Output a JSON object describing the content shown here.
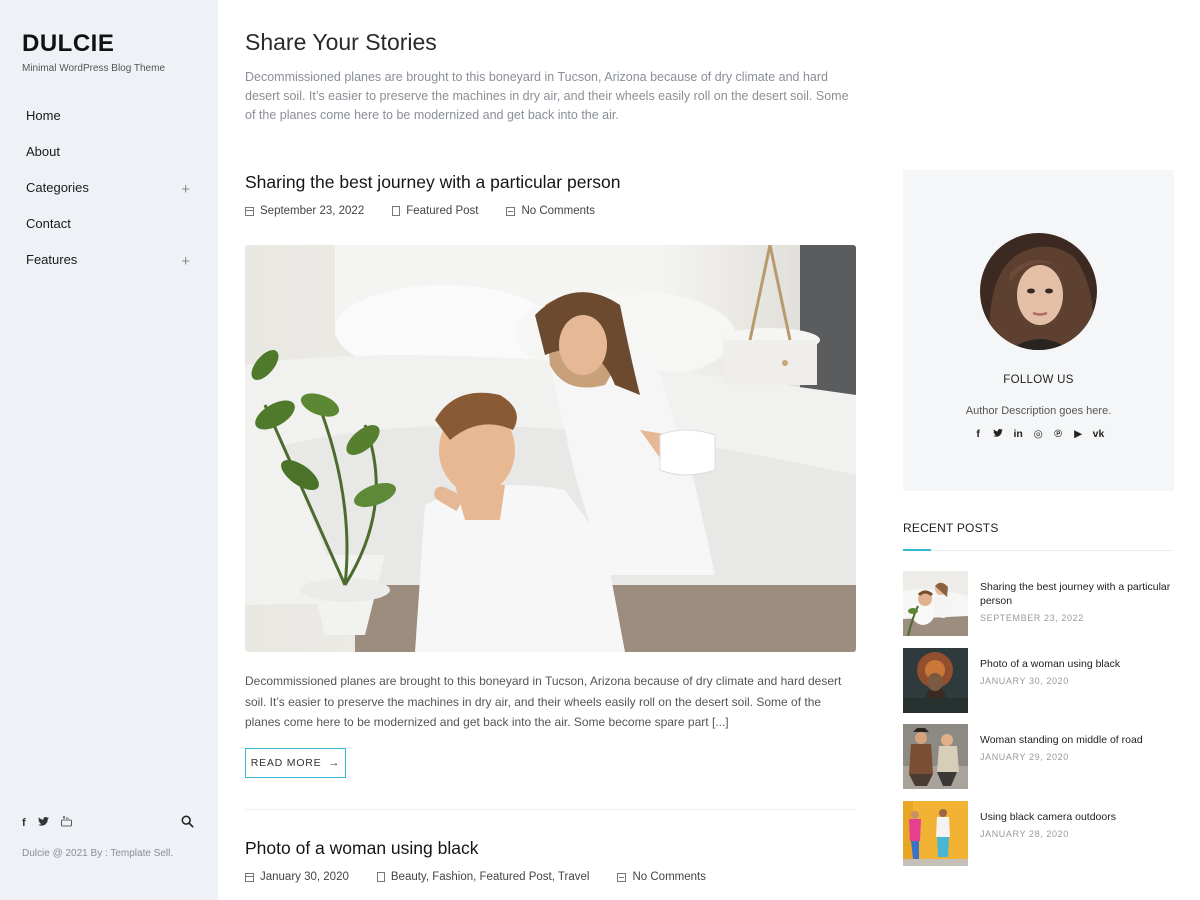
{
  "brand": {
    "name": "DULCIE",
    "tagline": "Minimal WordPress Blog Theme"
  },
  "nav": {
    "items": [
      {
        "label": "Home",
        "expandable": false
      },
      {
        "label": "About",
        "expandable": false
      },
      {
        "label": "Categories",
        "expandable": true,
        "expander": "+"
      },
      {
        "label": "Contact",
        "expandable": false
      },
      {
        "label": "Features",
        "expandable": true,
        "expander": "+"
      }
    ]
  },
  "left_footer": {
    "social": [
      {
        "icon": "facebook-icon",
        "glyph": "f"
      },
      {
        "icon": "twitter-icon",
        "glyph": "🐦"
      },
      {
        "icon": "youtube-icon",
        "glyph": "▶"
      }
    ],
    "search_icon": "search-icon",
    "copyright": "Dulcie @ 2021 By : Template Sell."
  },
  "page": {
    "title": "Share Your Stories",
    "intro": "Decommissioned planes are brought to this boneyard in Tucson, Arizona because of dry climate and hard desert soil. It’s easier to preserve the machines in dry air, and their wheels easily roll on the desert soil. Some of the planes come here to be modernized and get back into the air."
  },
  "posts": [
    {
      "title": "Sharing the best journey with a particular person",
      "date": "September 23, 2022",
      "categories": "Featured Post",
      "comments": "No Comments",
      "excerpt": "Decommissioned planes are brought to this boneyard in Tucson, Arizona because of dry climate and hard desert soil. It’s easier to preserve the machines in dry air, and their wheels easily roll on the desert soil. Some of the planes come here to be modernized and get back into the air. Some become spare part [...]",
      "read_more": "READ MORE",
      "read_more_arrow": "→"
    },
    {
      "title": "Photo of a woman using black",
      "date": "January 30, 2020",
      "categories": "Beauty, Fashion, Featured Post, Travel",
      "comments": "No Comments"
    }
  ],
  "author": {
    "follow_title": "FOLLOW US",
    "description": "Author Description goes here.",
    "social": [
      {
        "icon": "facebook-icon",
        "glyph": "f"
      },
      {
        "icon": "twitter-icon",
        "glyph": "t"
      },
      {
        "icon": "linkedin-icon",
        "glyph": "in"
      },
      {
        "icon": "instagram-icon",
        "glyph": "◎"
      },
      {
        "icon": "pinterest-icon",
        "glyph": "℗"
      },
      {
        "icon": "youtube-icon",
        "glyph": "▶"
      },
      {
        "icon": "vk-icon",
        "glyph": "vk"
      }
    ]
  },
  "recent_posts": {
    "title": "RECENT POSTS",
    "items": [
      {
        "name": "Sharing the best journey with a particular person",
        "date": "SEPTEMBER 23, 2022"
      },
      {
        "name": "Photo of a woman using black",
        "date": "JANUARY 30, 2020"
      },
      {
        "name": "Woman standing on middle of road",
        "date": "JANUARY 29, 2020"
      },
      {
        "name": "Using black camera outdoors",
        "date": "JANUARY 28, 2020"
      }
    ]
  },
  "colors": {
    "accent": "#37b7d3",
    "sidebar_bg": "#eef2f6",
    "muted_text": "#8a8f96"
  }
}
